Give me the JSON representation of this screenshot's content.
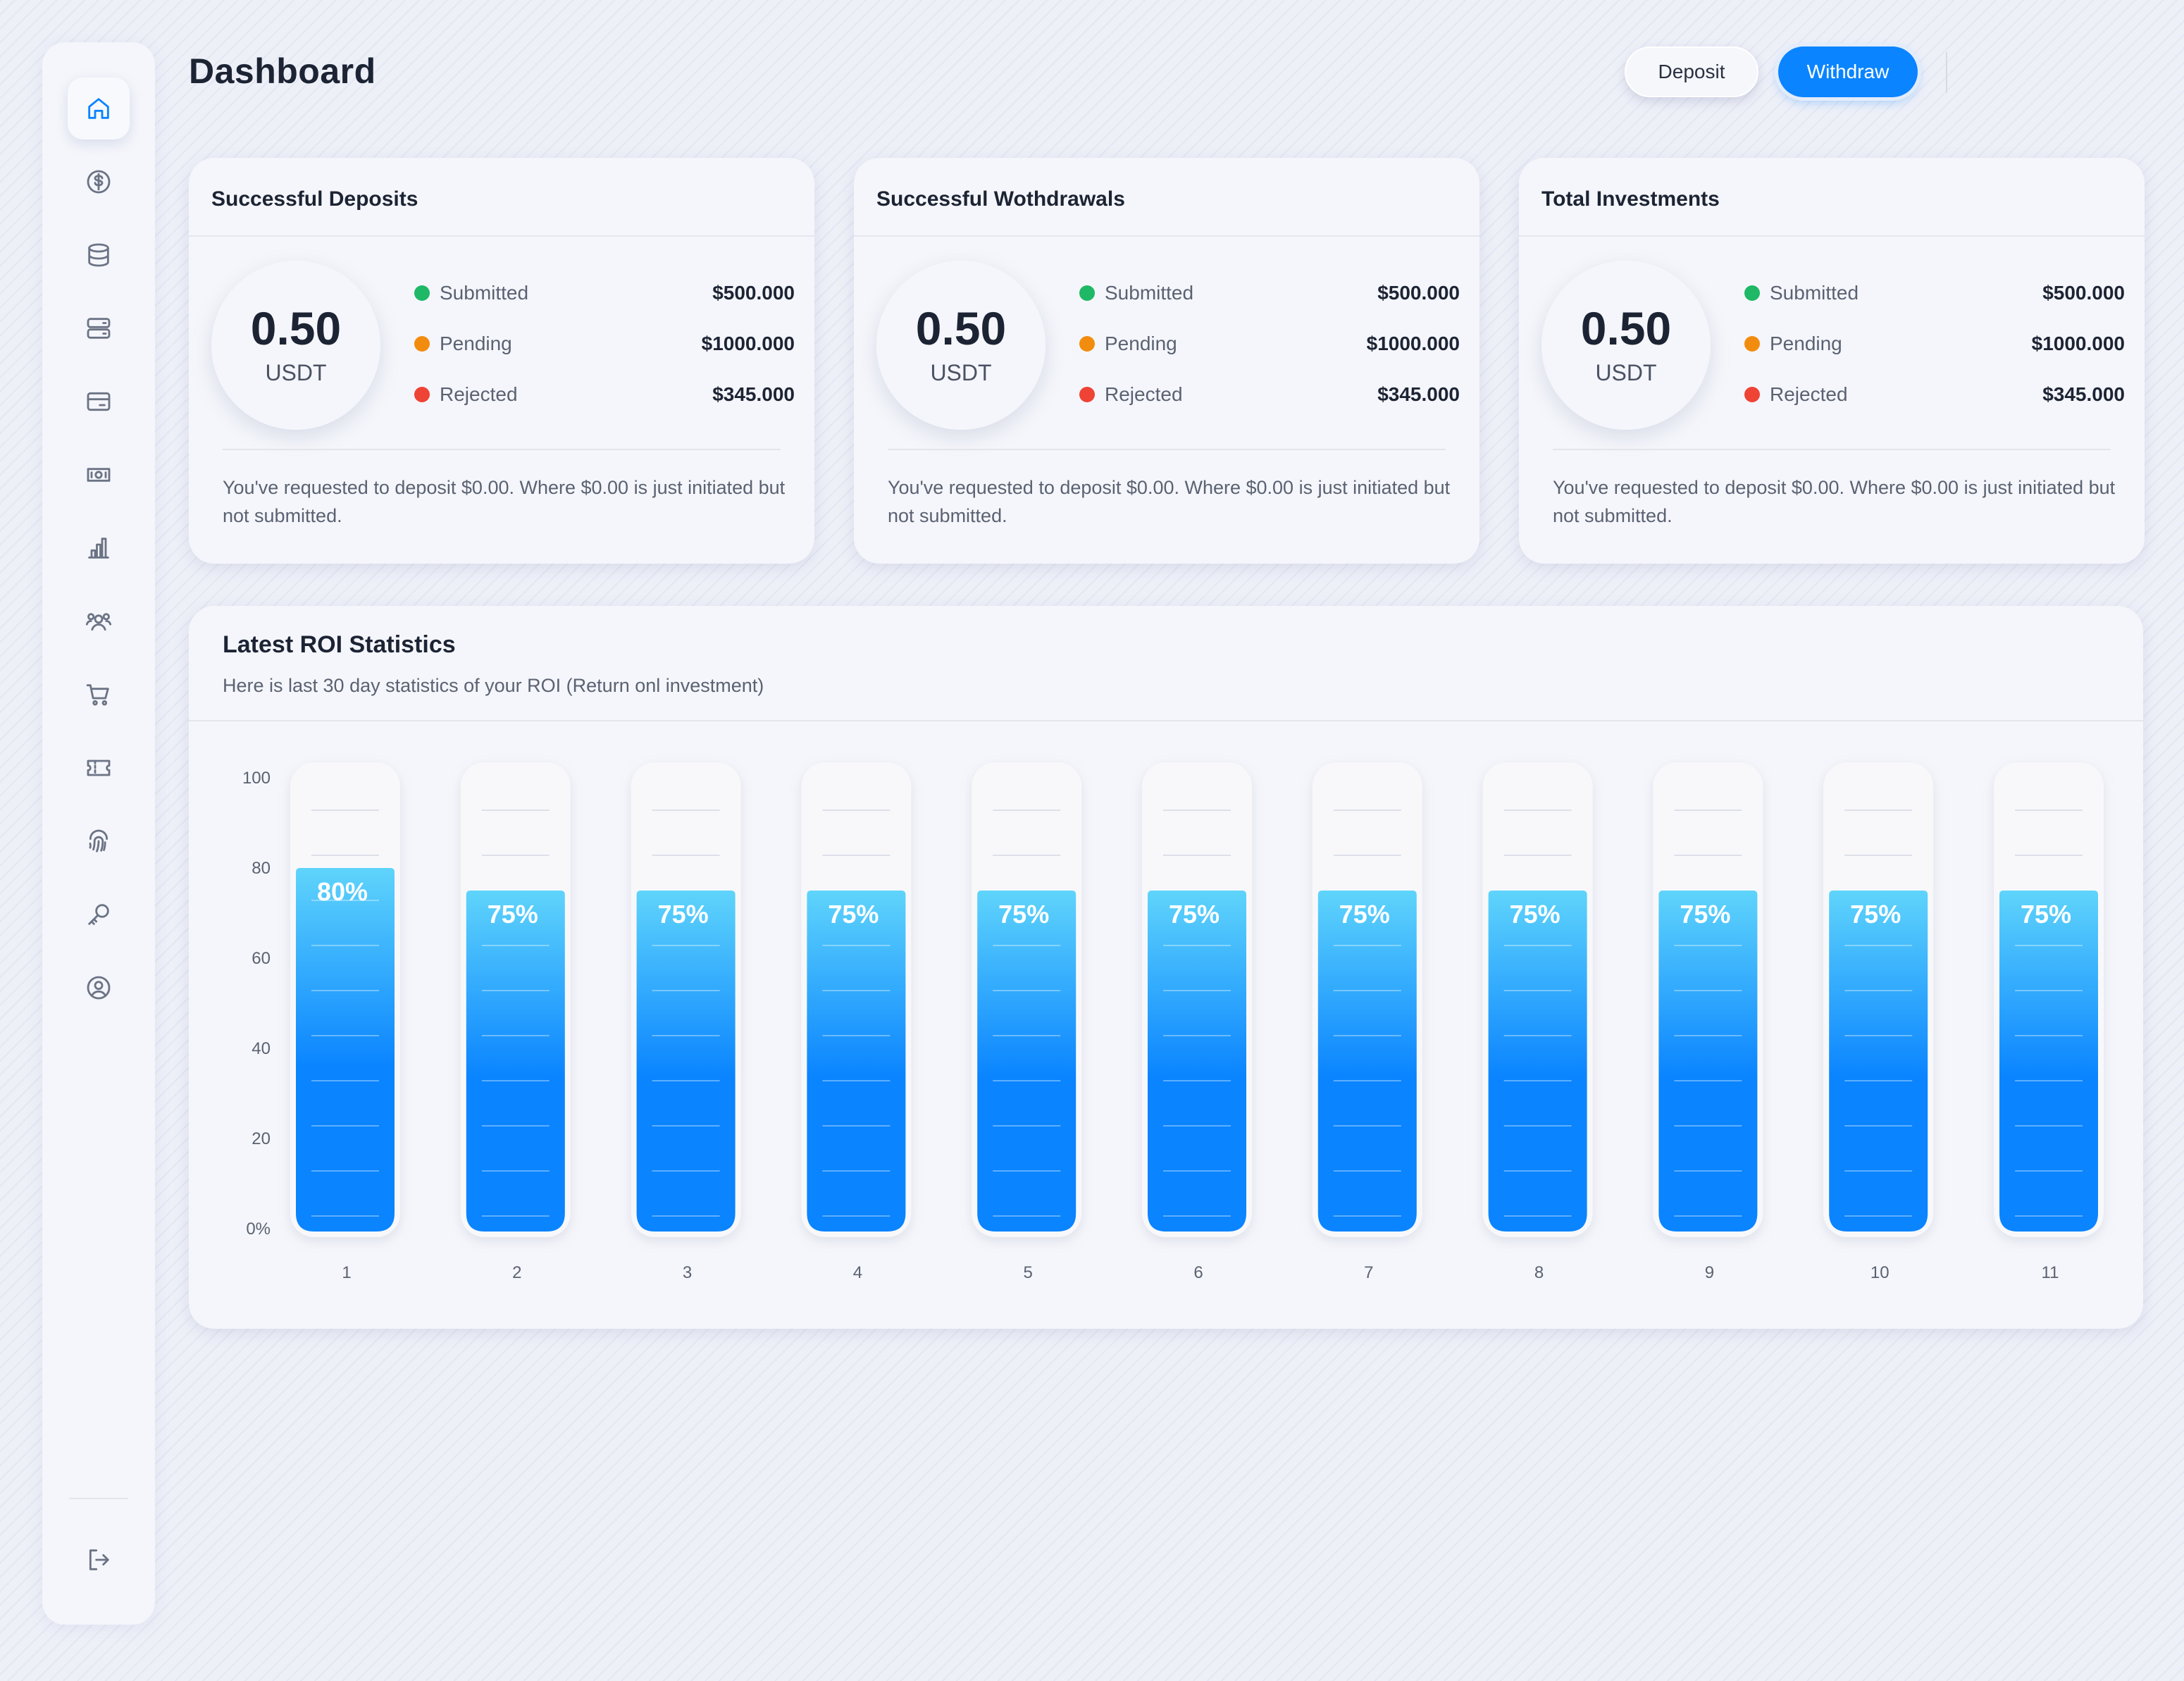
{
  "header": {
    "title": "Dashboard",
    "deposit_label": "Deposit",
    "withdraw_label": "Withdraw"
  },
  "sidebar": {
    "items": [
      {
        "icon": "home-icon",
        "active": true
      },
      {
        "icon": "dollar-circle-icon"
      },
      {
        "icon": "database-icon"
      },
      {
        "icon": "server-icon"
      },
      {
        "icon": "credit-card-icon"
      },
      {
        "icon": "banknote-icon"
      },
      {
        "icon": "bar-chart-icon"
      },
      {
        "icon": "users-icon"
      },
      {
        "icon": "cart-icon"
      },
      {
        "icon": "ticket-icon"
      },
      {
        "icon": "fingerprint-icon"
      },
      {
        "icon": "key-icon"
      },
      {
        "icon": "user-circle-icon"
      }
    ],
    "logout_icon": "logout-icon"
  },
  "cards": [
    {
      "title": "Successful Deposits",
      "value": "0.50",
      "unit": "USDT",
      "rows": [
        {
          "label": "Submitted",
          "value": "$500.000",
          "color": "#1fb866"
        },
        {
          "label": "Pending",
          "value": "$1000.000",
          "color": "#f28c0f"
        },
        {
          "label": "Rejected",
          "value": "$345.000",
          "color": "#ee4335"
        }
      ],
      "note": "You've requested to deposit $0.00. Where $0.00 is just initiated but not submitted."
    },
    {
      "title": "Successful Wothdrawals",
      "value": "0.50",
      "unit": "USDT",
      "rows": [
        {
          "label": "Submitted",
          "value": "$500.000",
          "color": "#1fb866"
        },
        {
          "label": "Pending",
          "value": "$1000.000",
          "color": "#f28c0f"
        },
        {
          "label": "Rejected",
          "value": "$345.000",
          "color": "#ee4335"
        }
      ],
      "note": "You've requested to deposit $0.00. Where $0.00 is just initiated but not submitted."
    },
    {
      "title": "Total Investments",
      "value": "0.50",
      "unit": "USDT",
      "rows": [
        {
          "label": "Submitted",
          "value": "$500.000",
          "color": "#1fb866"
        },
        {
          "label": "Pending",
          "value": "$1000.000",
          "color": "#f28c0f"
        },
        {
          "label": "Rejected",
          "value": "$345.000",
          "color": "#ee4335"
        }
      ],
      "note": "You've requested to deposit $0.00. Where $0.00 is just initiated but not submitted."
    }
  ],
  "roi": {
    "title": "Latest ROI Statistics",
    "subtitle": "Here is last 30 day statistics of your ROI (Return onl investment)"
  },
  "chart_data": {
    "type": "bar",
    "categories": [
      "1",
      "2",
      "3",
      "4",
      "5",
      "6",
      "7",
      "8",
      "9",
      "10",
      "11"
    ],
    "values": [
      80,
      75,
      75,
      75,
      75,
      75,
      75,
      75,
      75,
      75,
      75
    ],
    "value_labels": [
      "80%",
      "75%",
      "75%",
      "75%",
      "75%",
      "75%",
      "75%",
      "75%",
      "75%",
      "75%",
      "75%"
    ],
    "y_ticks": [
      "0%",
      "20",
      "40",
      "60",
      "80",
      "100"
    ],
    "ylim": [
      0,
      100
    ],
    "colors": {
      "bar_top": "#5fd4fb",
      "bar_bottom": "#0a84ff"
    }
  }
}
